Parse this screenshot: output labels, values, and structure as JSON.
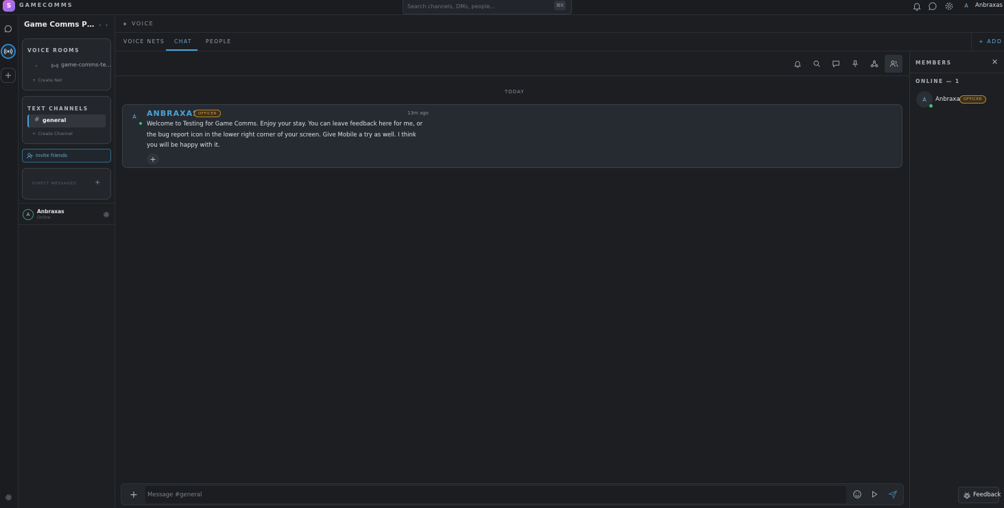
{
  "app": {
    "logo_letter": "S",
    "brand": "GAMECOMMS"
  },
  "search": {
    "placeholder": "Search channels, DMs, people...",
    "shortcut": "⌘K"
  },
  "user": {
    "avatar_letter": "A",
    "name": "Anbraxas",
    "status": "Online"
  },
  "server": {
    "name": "Game Comms Public..."
  },
  "voice_rooms": {
    "heading": "VOICE ROOMS",
    "items": [
      {
        "label": "game-comms-te..."
      }
    ],
    "create_label": "Create Net"
  },
  "text_channels": {
    "heading": "TEXT CHANNELS",
    "items": [
      {
        "label": "general",
        "active": true
      }
    ],
    "create_label": "Create Channel"
  },
  "invite": {
    "label": "Invite friends"
  },
  "dm": {
    "heading": "DIRECT MESSAGES"
  },
  "breadcrumb": {
    "label": "VOICE"
  },
  "tabs": [
    {
      "label": "VOICE NETS",
      "active": false
    },
    {
      "label": "CHAT",
      "active": true
    },
    {
      "label": "PEOPLE",
      "active": false
    }
  ],
  "add_label": "ADD",
  "chat": {
    "date_divider": "TODAY",
    "messages": [
      {
        "avatar_letter": "A",
        "author": "ANBRAXAS",
        "role": "OFFICER",
        "time": "13m ago",
        "text": "Welcome to Testing for Game Comms. Enjoy your stay. You can leave feedback here for me, or the bug report icon in the lower right corner of your screen. Give Mobile a try as well. I think you will be happy with it.",
        "reaction_label": "+"
      }
    ]
  },
  "composer": {
    "placeholder": "Message #general"
  },
  "members": {
    "heading": "MEMBERS",
    "online_heading": "ONLINE — 1",
    "list": [
      {
        "avatar_letter": "A",
        "name": "Anbraxas",
        "role": "OFFICER"
      }
    ]
  },
  "feedback": {
    "label": "Feedback"
  },
  "colors": {
    "accent": "#4aa3d8",
    "officer": "#d9a646",
    "online": "#3cc07a"
  }
}
